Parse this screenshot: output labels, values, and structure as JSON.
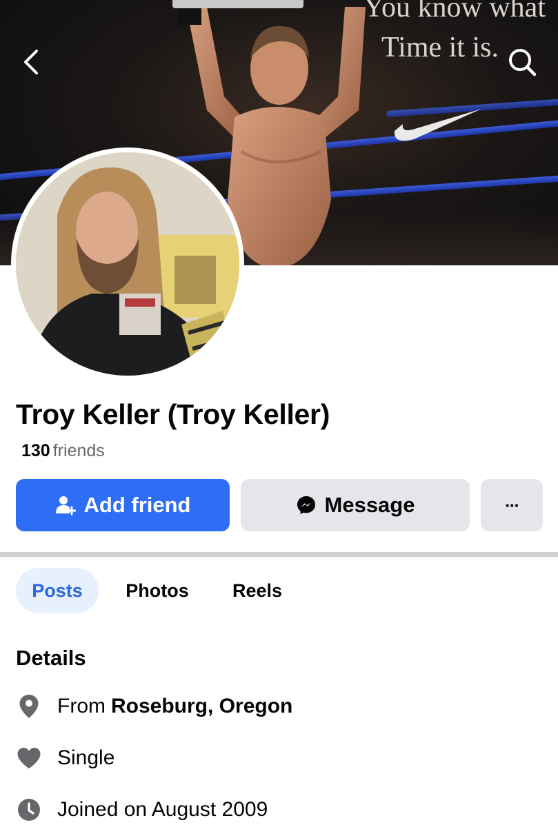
{
  "cover": {
    "quote_line1": "You know what",
    "quote_line2": "Time it is."
  },
  "header": {
    "back_icon": "chevron-left-icon",
    "search_icon": "search-icon"
  },
  "profile": {
    "name": "Troy Keller (Troy Keller)",
    "friends_count": "130",
    "friends_label": "friends"
  },
  "actions": {
    "add_friend_label": "Add friend",
    "message_label": "Message",
    "more_label": "···"
  },
  "tabs": [
    {
      "label": "Posts",
      "selected": true
    },
    {
      "label": "Photos",
      "selected": false
    },
    {
      "label": "Reels",
      "selected": false
    }
  ],
  "details": {
    "title": "Details",
    "from_prefix": "From",
    "from_value": "Roseburg, Oregon",
    "relationship": "Single",
    "joined": "Joined on August 2009"
  },
  "colors": {
    "accent": "#2e6ef6",
    "secondary_button": "#e4e6eb",
    "selected_tab_bg": "#e7f0fd",
    "selected_tab_text": "#2b68d9",
    "muted_text": "#65676b"
  }
}
